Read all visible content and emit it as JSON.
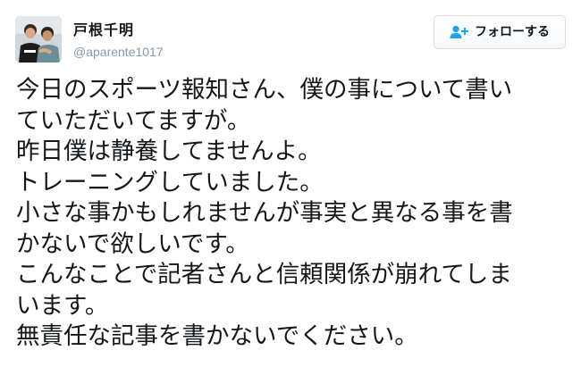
{
  "tweet": {
    "author": {
      "display_name": "戸根千明",
      "handle": "@aparente1017"
    },
    "follow_button": {
      "label": "フォローする",
      "icon": "follow-person-plus-icon"
    },
    "text_lines": [
      "今日のスポーツ報知さん、僕の事について書い",
      "ていただいてますが。",
      "昨日僕は静養してませんよ。",
      "トレーニングしていました。",
      "小さな事かもしれませんが事実と異なる事を書",
      "かないで欲しいです。",
      "こんなことで記者さんと信頼関係が崩れてしま",
      "います。",
      "無責任な記事を書かないでください。"
    ]
  },
  "colors": {
    "text": "#14171a",
    "muted": "#8899a6",
    "accent": "#1da1f2",
    "button_border": "#d8dfe6"
  }
}
